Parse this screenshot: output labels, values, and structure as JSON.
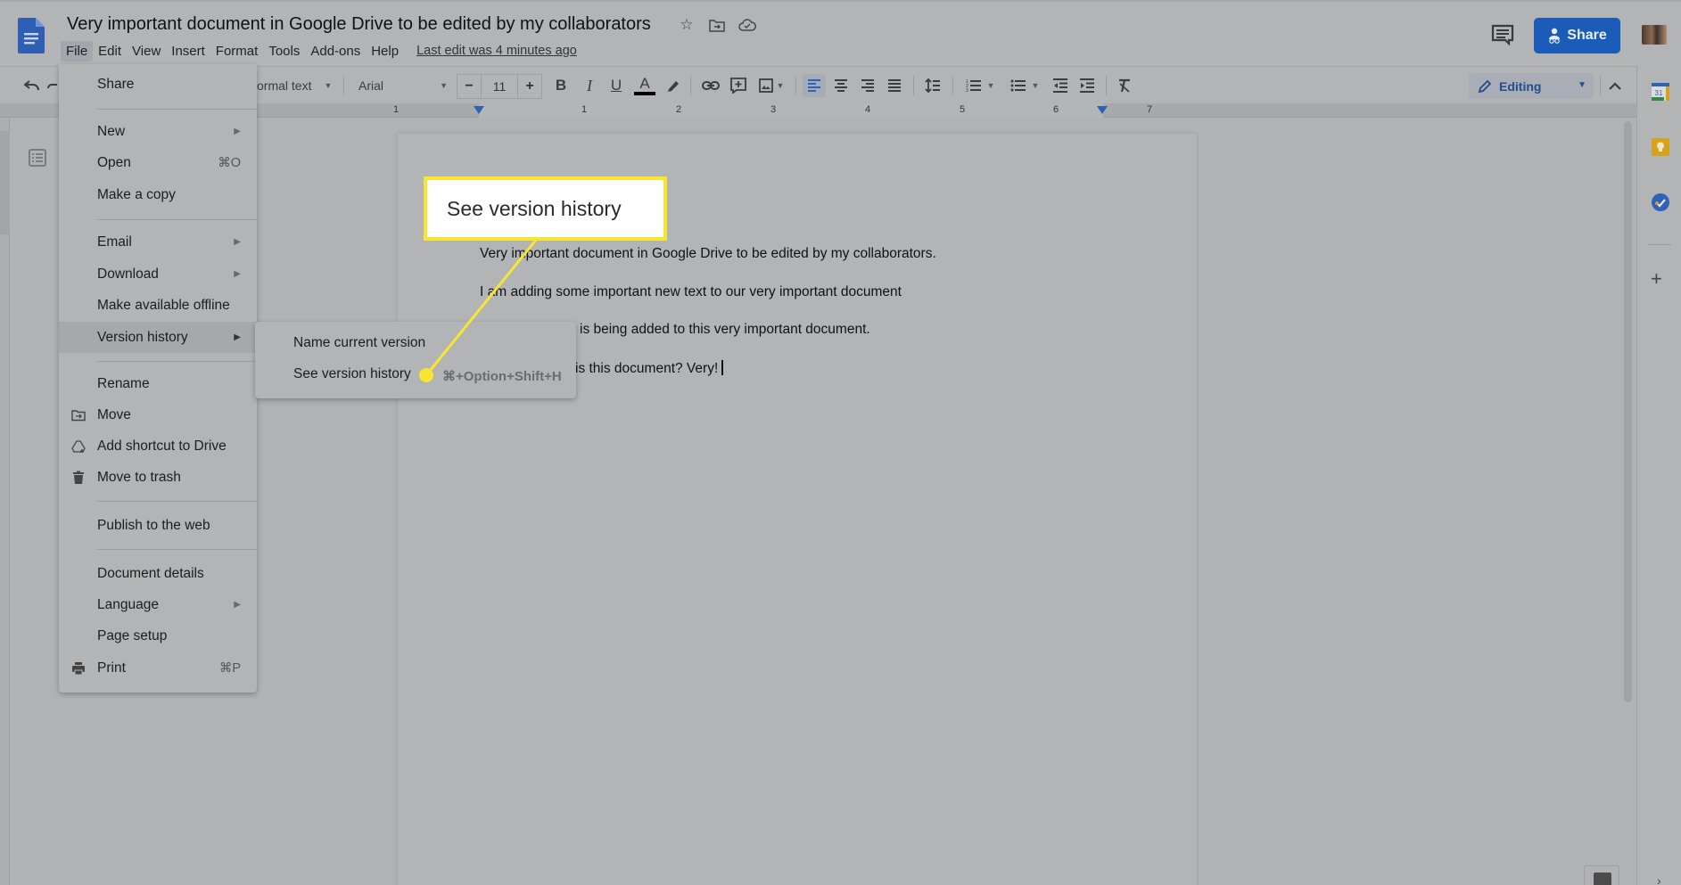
{
  "header": {
    "title": "Very important document in Google Drive to be edited by my collaborators",
    "title_icons": [
      "star-icon",
      "move-to-folder-icon",
      "cloud-saved-icon"
    ],
    "menu": [
      "File",
      "Edit",
      "View",
      "Insert",
      "Format",
      "Tools",
      "Add-ons",
      "Help"
    ],
    "active_menu": "File",
    "last_edit": "Last edit was 4 minutes ago",
    "share_label": "Share",
    "brand_color": "#1a5cb8"
  },
  "toolbar": {
    "style_value": "Normal text",
    "style_visible": "ormal text",
    "font_value": "Arial",
    "font_size": "11",
    "decrease": "−",
    "increase": "+",
    "bold": "B",
    "italic": "I",
    "underline": "U",
    "text_color": "A",
    "mode_label": "Editing"
  },
  "ruler": {
    "labels": [
      "1",
      "1",
      "2",
      "3",
      "4",
      "5",
      "6",
      "7"
    ]
  },
  "file_menu": {
    "items": [
      {
        "label": "Share"
      },
      {
        "label": "New",
        "submenu": true
      },
      {
        "label": "Open",
        "shortcut": "⌘O"
      },
      {
        "label": "Make a copy"
      },
      {
        "label": "Email",
        "submenu": true
      },
      {
        "label": "Download",
        "submenu": true
      },
      {
        "label": "Make available offline"
      },
      {
        "label": "Version history",
        "submenu": true,
        "highlighted": true
      },
      {
        "label": "Rename"
      },
      {
        "label": "Move",
        "icon": "move-folder-icon"
      },
      {
        "label": "Add shortcut to Drive",
        "icon": "drive-shortcut-icon"
      },
      {
        "label": "Move to trash",
        "icon": "trash-icon"
      },
      {
        "label": "Publish to the web"
      },
      {
        "label": "Document details"
      },
      {
        "label": "Language",
        "submenu": true
      },
      {
        "label": "Page setup"
      },
      {
        "label": "Print",
        "shortcut": "⌘P",
        "icon": "print-icon"
      }
    ]
  },
  "version_submenu": {
    "items": [
      {
        "label": "Name current version"
      },
      {
        "label": "See version history",
        "shortcut": "⌘+Option+Shift+H"
      }
    ]
  },
  "callout": {
    "label": "See version history",
    "color": "#f6e631"
  },
  "document": {
    "paragraphs": [
      "Very important document in Google Drive to be edited by my collaborators.",
      "I am adding some important new text to our very important document",
      "is being added to this very important document.",
      "is this document? Very!"
    ]
  },
  "side_panel": {
    "icons": [
      "calendar-icon",
      "keep-icon",
      "tasks-icon",
      "add-icon"
    ],
    "calendar_day": "31"
  }
}
